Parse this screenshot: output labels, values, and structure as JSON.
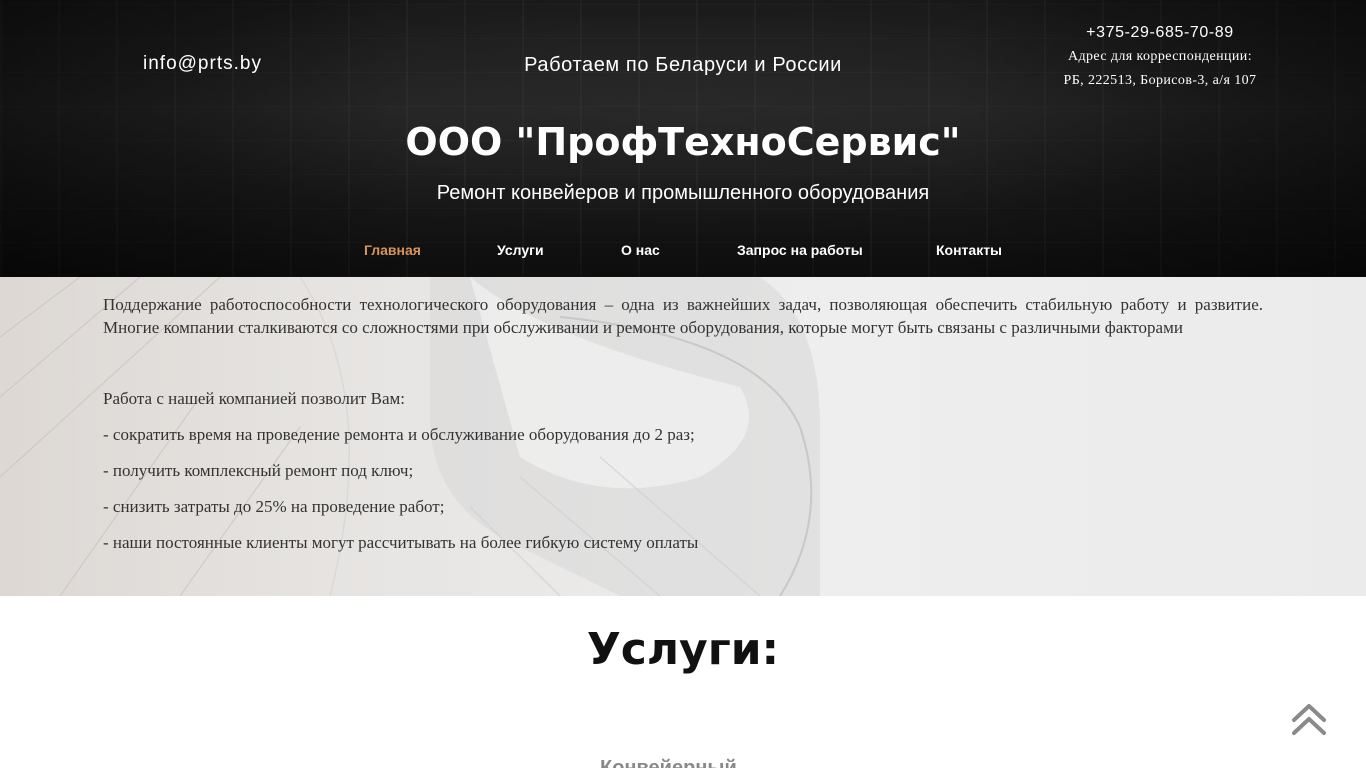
{
  "header": {
    "email": "info@prts.by",
    "region": "Работаем по Беларуси и России",
    "phone": "+375-29-685-70-89",
    "address_label": "Адрес для корреспонденции:",
    "address_value": "РБ, 222513, Борисов-3, а/я 107",
    "company": "ООО \"ПрофТехноСервис\"",
    "slogan": "Ремонт конвейеров и промышленного оборудования"
  },
  "nav": {
    "items": [
      {
        "label": "Главная",
        "active": true
      },
      {
        "label": "Услуги",
        "active": false
      },
      {
        "label": "О нас",
        "active": false
      },
      {
        "label": "Запрос на работы",
        "active": false
      },
      {
        "label": "Контакты",
        "active": false
      }
    ]
  },
  "intro": {
    "paragraph": "Поддержание работоспособности технологического оборудования – одна из важнейших задач, позволяющая обеспечить стабильную работу и развитие. Многие компании сталкиваются со сложностями при обслуживании и ремонте оборудования, которые могут быть связаны с различными факторами",
    "lead": "Работа с нашей компанией позволит Вам:",
    "bullets": [
      "- сократить время на проведение ремонта и обслуживание оборудования до 2 раз;",
      "- получить комплексный ремонт под ключ;",
      "- снизить затраты до 25% на проведение работ;",
      "- наши постоянные клиенты могут рассчитывать на более гибкую систему оплаты"
    ]
  },
  "services": {
    "title": "Услуги:",
    "next_heading_partial": "Конвейерный"
  },
  "icons": {
    "scroll_top": "double-chevron-up-icon"
  },
  "colors": {
    "nav_active": "#d9935c",
    "header_text": "#ffffff",
    "body_text": "#333333"
  }
}
